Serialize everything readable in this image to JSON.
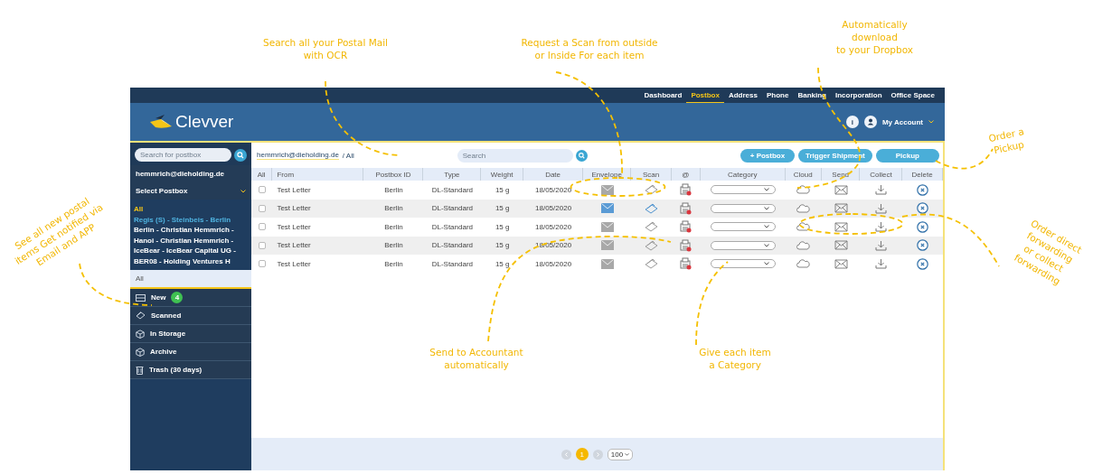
{
  "callouts": [
    {
      "text": "Search all your Postal Mail\nwith OCR"
    },
    {
      "text": "Request a Scan from outside\nor Inside For each item"
    },
    {
      "text": "Automatically\ndownload\nto your Dropbox"
    },
    {
      "text": "Order a\nPickup"
    },
    {
      "text": "See all new postal\nitems Get notified via\nEmail and APP"
    },
    {
      "text": "Order direct\nforwarding\nor collect\nforwarding"
    },
    {
      "text": "Send to Accountant\nautomatically"
    },
    {
      "text": "Give each item\na Category"
    }
  ],
  "top_nav": [
    {
      "label": "Dashboard",
      "selected": false
    },
    {
      "label": "Postbox",
      "selected": true
    },
    {
      "label": "Address",
      "selected": false
    },
    {
      "label": "Phone",
      "selected": false
    },
    {
      "label": "Banking",
      "selected": false
    },
    {
      "label": "Incorporation",
      "selected": false
    },
    {
      "label": "Office Space",
      "selected": false
    }
  ],
  "header": {
    "logo": "Clevver",
    "info": "i",
    "account": "My Account"
  },
  "sidebar": {
    "search_placeholder": "Search for postbox",
    "account_email": "hemmrich@dieholding.de",
    "select_label": "Select Postbox",
    "postboxes": [
      {
        "label": "All",
        "color": "#f5c518"
      },
      {
        "label": "Regis (S) - Steinbeis - Berlin",
        "color": "#4fb3e0"
      },
      {
        "label": "Berlin - Christian Hemmrich -",
        "color": "#ffffff"
      },
      {
        "label": "Hanoi - Christian Hemmrich -",
        "color": "#ffffff"
      },
      {
        "label": "IceBear - IceBear Capital UG -",
        "color": "#ffffff"
      },
      {
        "label": "BER08 - Holding Ventures H",
        "color": "#ffffff"
      }
    ],
    "folders": [
      {
        "label": "All",
        "kind": "all",
        "selected": true
      },
      {
        "label": "New",
        "kind": "new",
        "badge": "4",
        "selected": false
      },
      {
        "label": "Scanned",
        "kind": "scanned",
        "selected": false
      },
      {
        "label": "In Storage",
        "kind": "storage",
        "selected": false
      },
      {
        "label": "Archive",
        "kind": "archive",
        "selected": false
      },
      {
        "label": "Trash (30 days)",
        "kind": "trash",
        "selected": false
      }
    ]
  },
  "toolbar": {
    "breadcrumb_account": "hemmrich@dieholding.de",
    "breadcrumb_path": "/ All",
    "search_placeholder": "Search",
    "buttons": [
      "+ Postbox",
      "Trigger Shipment",
      "Pickup"
    ]
  },
  "table": {
    "columns": [
      "All",
      "From",
      "Postbox ID",
      "Type",
      "Weight",
      "Date",
      "Envelope",
      "Scan",
      "@",
      "Category",
      "Cloud",
      "Send",
      "Collect",
      "Delete"
    ],
    "rows": [
      {
        "checked": false,
        "from": "Test Letter",
        "postbox_id": "Berlin",
        "type": "DL-Standard",
        "weight": "15 g",
        "date": "18/05/2020",
        "scanned": false
      },
      {
        "checked": false,
        "from": "Test Letter",
        "postbox_id": "Berlin",
        "type": "DL-Standard",
        "weight": "15 g",
        "date": "18/05/2020",
        "scanned": true
      },
      {
        "checked": false,
        "from": "Test Letter",
        "postbox_id": "Berlin",
        "type": "DL-Standard",
        "weight": "15 g",
        "date": "18/05/2020",
        "scanned": false
      },
      {
        "checked": false,
        "from": "Test Letter",
        "postbox_id": "Berlin",
        "type": "DL-Standard",
        "weight": "15 g",
        "date": "18/05/2020",
        "scanned": false
      },
      {
        "checked": false,
        "from": "Test Letter",
        "postbox_id": "Berlin",
        "type": "DL-Standard",
        "weight": "15 g",
        "date": "18/05/2020",
        "scanned": false
      }
    ]
  },
  "pagination": {
    "pages": [
      {
        "label": "1",
        "selected": true
      }
    ],
    "page_size": "100"
  }
}
